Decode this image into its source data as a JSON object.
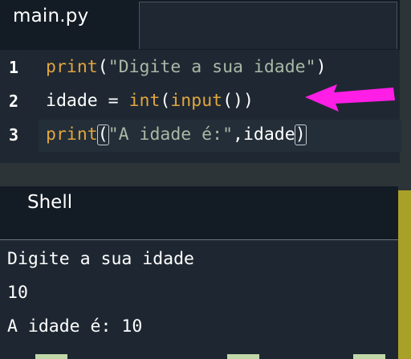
{
  "editor": {
    "tab_label": "main.py",
    "lines": [
      {
        "num": "1",
        "parts": [
          "print",
          "(",
          "\"Digite a sua idade\"",
          ")"
        ]
      },
      {
        "num": "2",
        "parts": [
          "idade = ",
          "int",
          "(",
          "input",
          "())"
        ]
      },
      {
        "num": "3",
        "parts": [
          "print",
          "(",
          "\"A idade é:\"",
          ",idade",
          ")"
        ]
      }
    ]
  },
  "shell": {
    "title": "Shell",
    "output": [
      "Digite a sua idade",
      "10",
      "A idade é: 10"
    ]
  },
  "colors": {
    "keyword": "#e0a53f",
    "string": "#a8b8a6",
    "text": "#ffffff",
    "arrow": "#ff1ee6",
    "background": "#1d2631"
  }
}
